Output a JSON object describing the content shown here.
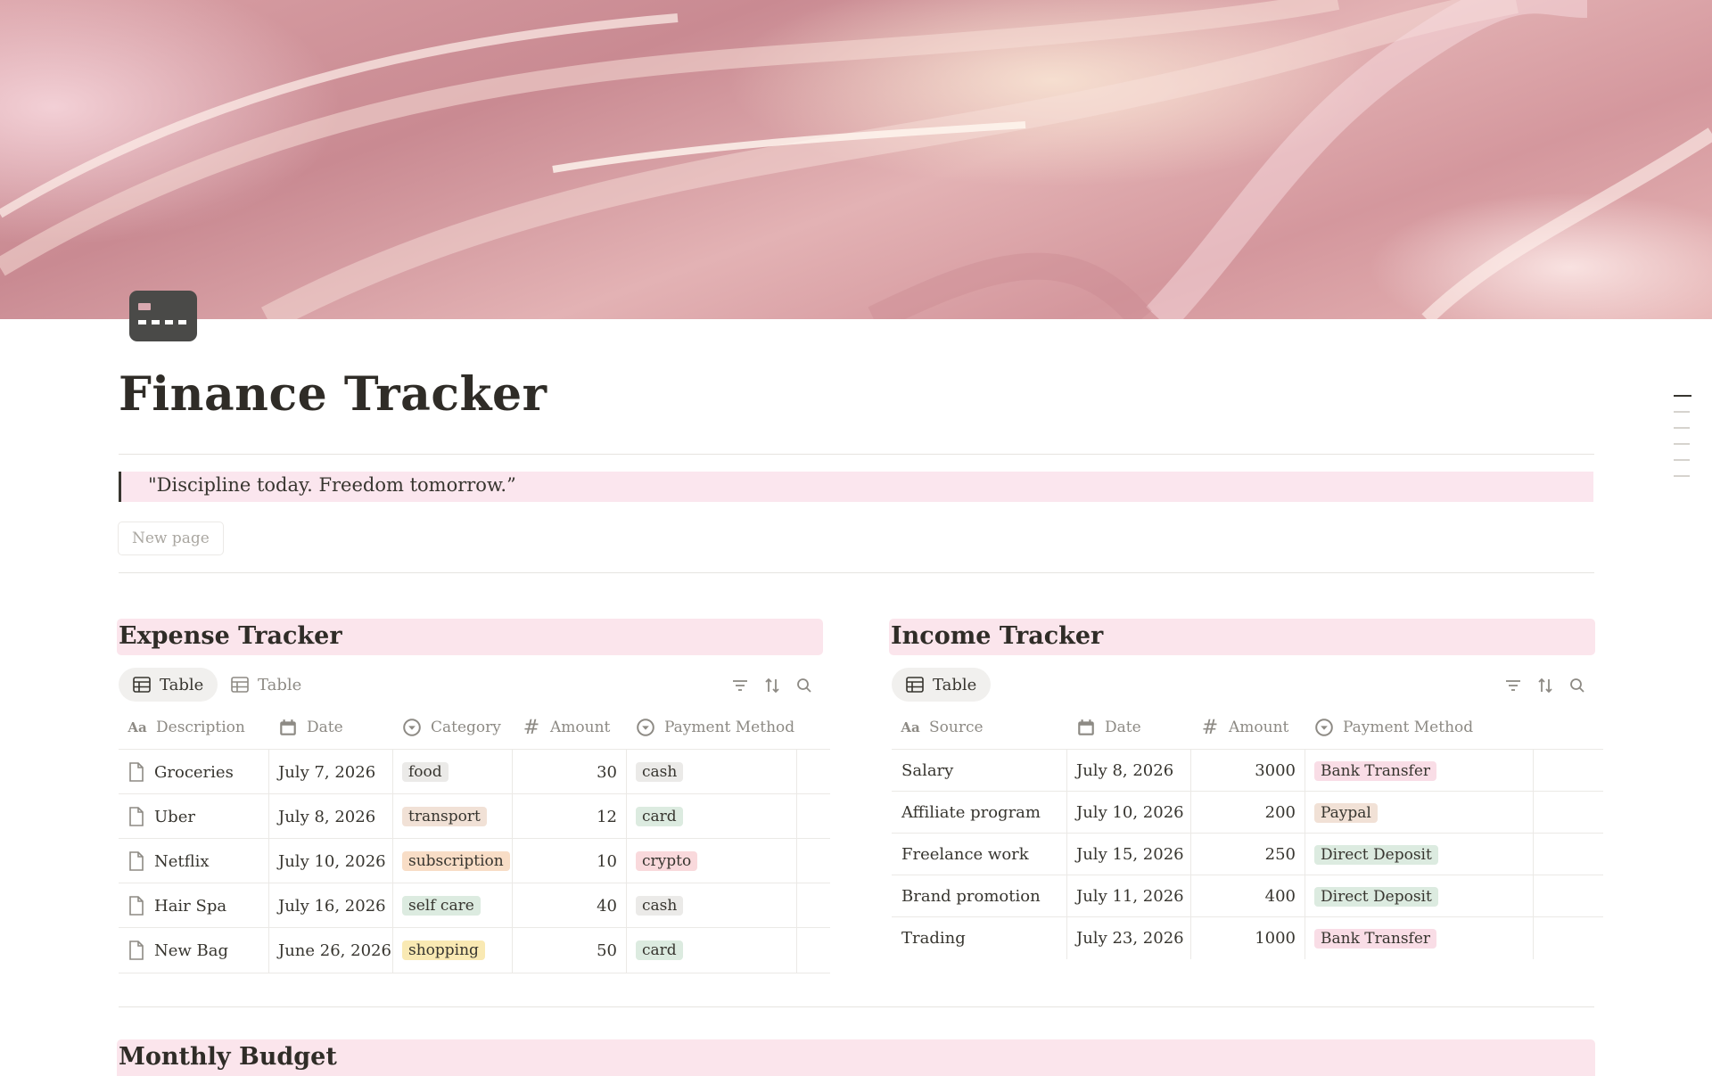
{
  "page": {
    "title": "Finance Tracker",
    "quote": "\"Discipline today. Freedom tomorrow.”",
    "new_page_label": "New page",
    "icon": "credit-card-icon"
  },
  "colors": {
    "section_header_bg": "#fbe5ec",
    "quote_bg": "#fbe6ee",
    "tag_gray": "#ebeae8",
    "tag_brown": "#f1e1d6",
    "tag_orange": "#f8ddc6",
    "tag_green": "#dcebe0",
    "tag_red": "#f9d9dc",
    "tag_yellow": "#f9e9b3",
    "tag_pink": "#f9dde6"
  },
  "expense": {
    "title": "Expense Tracker",
    "tabs": [
      {
        "label": "Table",
        "active": true
      },
      {
        "label": "Table",
        "active": false
      }
    ],
    "columns": [
      "Description",
      "Date",
      "Category",
      "Amount",
      "Payment Method"
    ],
    "rows": [
      {
        "description": "Groceries",
        "date": "July 7, 2026",
        "category": "food",
        "amount": "30",
        "method": "cash"
      },
      {
        "description": "Uber",
        "date": "July 8, 2026",
        "category": "transport",
        "amount": "12",
        "method": "card"
      },
      {
        "description": "Netflix",
        "date": "July 10, 2026",
        "category": "subscription",
        "amount": "10",
        "method": "crypto"
      },
      {
        "description": "Hair Spa",
        "date": "July 16, 2026",
        "category": "self care",
        "amount": "40",
        "method": "cash"
      },
      {
        "description": "New Bag",
        "date": "June 26, 2026",
        "category": "shopping",
        "amount": "50",
        "method": "card"
      }
    ]
  },
  "income": {
    "title": "Income Tracker",
    "tabs": [
      {
        "label": "Table",
        "active": true
      }
    ],
    "columns": [
      "Source",
      "Date",
      "Amount",
      "Payment Method"
    ],
    "rows": [
      {
        "source": "Salary",
        "date": "July 8, 2026",
        "amount": "3000",
        "method": "Bank Transfer"
      },
      {
        "source": "Affiliate program",
        "date": "July 10, 2026",
        "amount": "200",
        "method": "Paypal"
      },
      {
        "source": "Freelance work",
        "date": "July 15, 2026",
        "amount": "250",
        "method": "Direct Deposit"
      },
      {
        "source": "Brand promotion",
        "date": "July 11, 2026",
        "amount": "400",
        "method": "Direct Deposit"
      },
      {
        "source": "Trading",
        "date": "July 23, 2026",
        "amount": "1000",
        "method": "Bank Transfer"
      }
    ]
  },
  "budget": {
    "title": "Monthly Budget"
  }
}
